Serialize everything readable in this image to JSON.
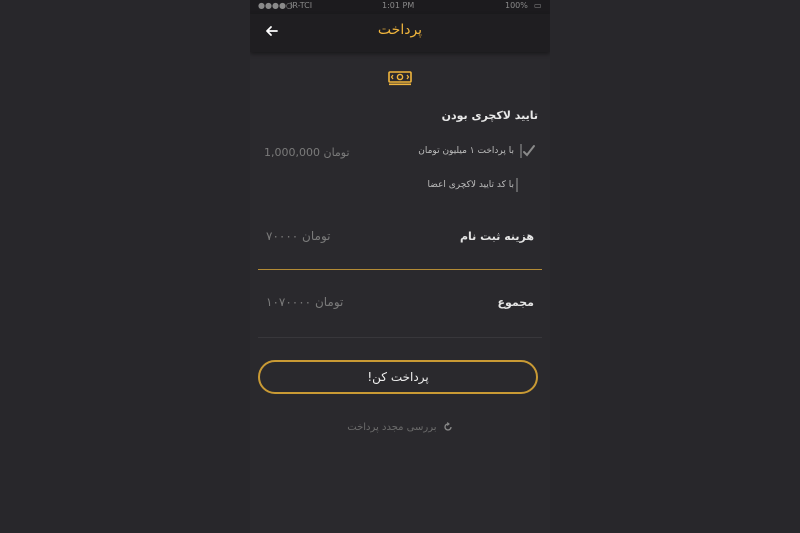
{
  "status_bar": {
    "carrier": "IR-TCI",
    "time": "1:01 PM",
    "battery": "100%"
  },
  "header": {
    "title": "پرداخت",
    "back_icon": "arrow-left-icon"
  },
  "money_icon": "money-bill-icon",
  "section": {
    "title": "تایید لاکچری بودن",
    "options": [
      {
        "label": "با پرداخت ۱ میلیون تومان",
        "amount": "1,000,000 تومان",
        "checked": true
      },
      {
        "label": "با کد تایید لاکچری اعضا",
        "checked": false
      }
    ]
  },
  "registration_fee": {
    "label": "هزینه ثبت نام",
    "amount": "۷۰۰۰۰ تومان"
  },
  "total": {
    "label": "مجموع",
    "amount": "۱۰۷۰۰۰۰ تومان"
  },
  "pay_button_label": "پرداخت کن!",
  "recheck_link": "بررسی مجدد پرداخت",
  "colors": {
    "accent": "#f0b53d",
    "background": "#2a292d",
    "header": "#1f1e21"
  }
}
